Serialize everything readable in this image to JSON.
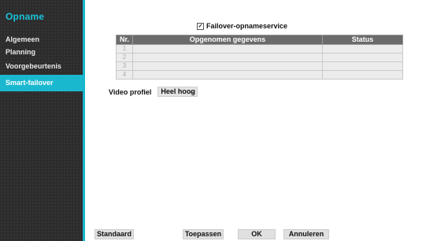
{
  "sidebar": {
    "title": "Opname",
    "items": [
      {
        "label": "Algemeen",
        "active": false
      },
      {
        "label": "Planning",
        "active": false
      },
      {
        "label": "Voorgebeurtenis",
        "active": false
      },
      {
        "label": "Smart-failover",
        "active": true
      }
    ]
  },
  "failover": {
    "label": "Failover-opnameservice",
    "checked": true,
    "check_glyph": "✓"
  },
  "table": {
    "headers": [
      "Nr.",
      "Opgenomen gegevens",
      "Status"
    ],
    "rows": [
      {
        "nr": "1",
        "data": "",
        "status": ""
      },
      {
        "nr": "2",
        "data": "",
        "status": ""
      },
      {
        "nr": "3",
        "data": "",
        "status": ""
      },
      {
        "nr": "4",
        "data": "",
        "status": ""
      }
    ]
  },
  "video_profile": {
    "label": "Video profiel",
    "value": "Heel hoog",
    "chevron_glyph": "⌄"
  },
  "buttons": {
    "standaard": "Standaard",
    "toepassen": "Toepassen",
    "ok": "OK",
    "annuleren": "Annuleren"
  },
  "colors": {
    "accent": "#1ab8cf",
    "sidebar_bg": "#2c2c2c",
    "table_header": "#6b6b6b"
  }
}
